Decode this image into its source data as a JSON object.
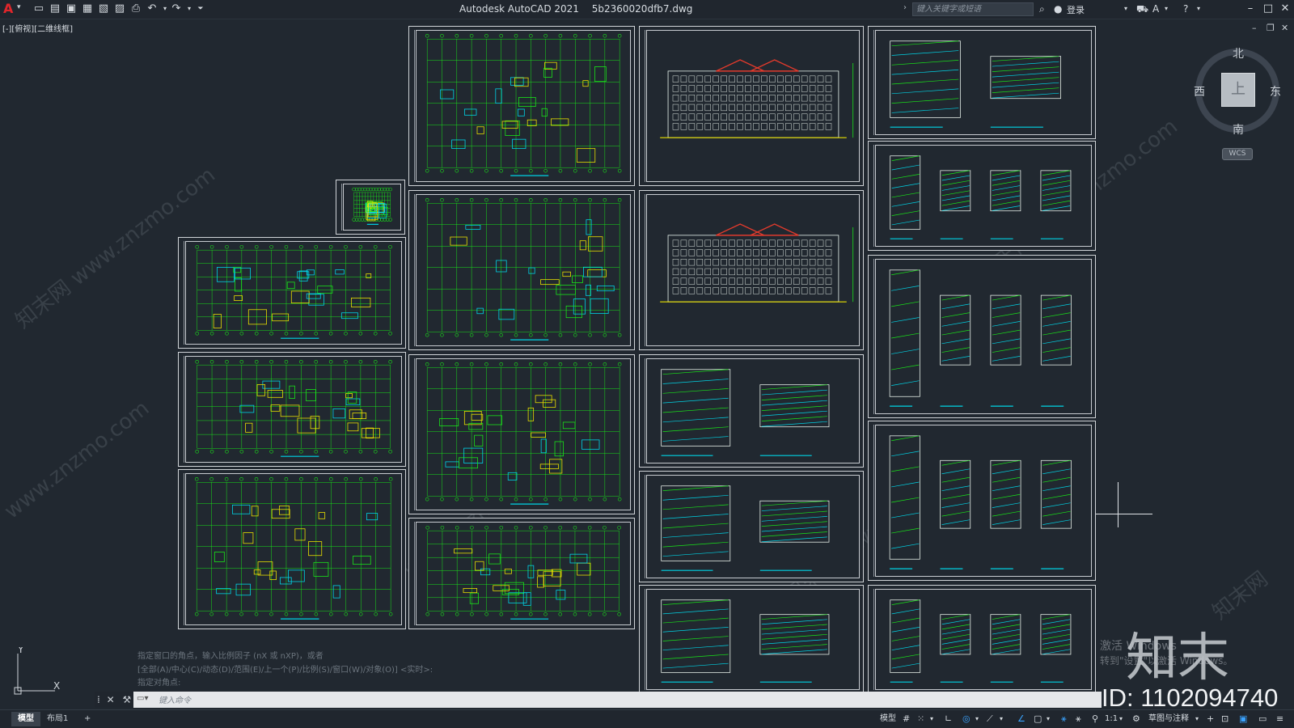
{
  "titlebar": {
    "app_name": "Autodesk AutoCAD 2021",
    "file_name": "5b2360020dfb7.dwg",
    "search_placeholder": "键入关键字或短语",
    "login_label": "登录"
  },
  "viewport_label": "[-][俯视][二维线框]",
  "viewcube": {
    "north": "北",
    "south": "南",
    "east": "东",
    "west": "西",
    "face": "上",
    "wcs": "WCS"
  },
  "command": {
    "history": [
      "指定窗口的角点，输入比例因子 (nX 或 nXP)，或者",
      "[全部(A)/中心(C)/动态(D)/范围(E)/上一个(P)/比例(S)/窗口(W)/对象(O)] <实时>:",
      "指定对角点:"
    ],
    "input_placeholder": "键入命令"
  },
  "status_tabs": [
    "模型",
    "布局1"
  ],
  "statusbar": {
    "model_label": "模型",
    "scale": "1:1",
    "annotation_label": "草图与注释"
  },
  "watermark": {
    "site": "www.znzmo.com",
    "cn_site": "知末网",
    "logo": "知末",
    "id": "ID: 1102094740",
    "activate_line1": "激活 Windows",
    "activate_line2": "转到\"设置\"以激活 Windows。"
  },
  "colors": {
    "background": "#212830",
    "drawing_lines": "#19e519",
    "accent_cyan": "#00d4e6",
    "accent_yellow": "#e8e000",
    "roof_red": "#e03a2c",
    "command_bar": "#e5e7ea"
  }
}
